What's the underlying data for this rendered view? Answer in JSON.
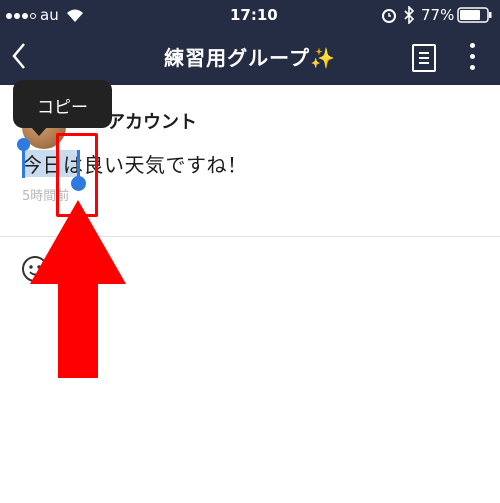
{
  "status_bar": {
    "carrier": "au",
    "time": "17:10",
    "battery": "77%",
    "icons": [
      "signal-icon",
      "wifi-icon",
      "alarm-icon",
      "bluetooth-icon",
      "battery-icon"
    ]
  },
  "nav": {
    "title": "練習用グループ✨",
    "icons": [
      "back-icon",
      "list-icon",
      "more-icon"
    ]
  },
  "post": {
    "author": "アカウント",
    "message": "今日は良い天気ですね！",
    "time": "5時間前"
  },
  "context_menu": {
    "copy_label": "コピー"
  },
  "colors": {
    "navbar": "#252d45",
    "selection": "#2d7be0",
    "annotation": "#ff0000"
  }
}
